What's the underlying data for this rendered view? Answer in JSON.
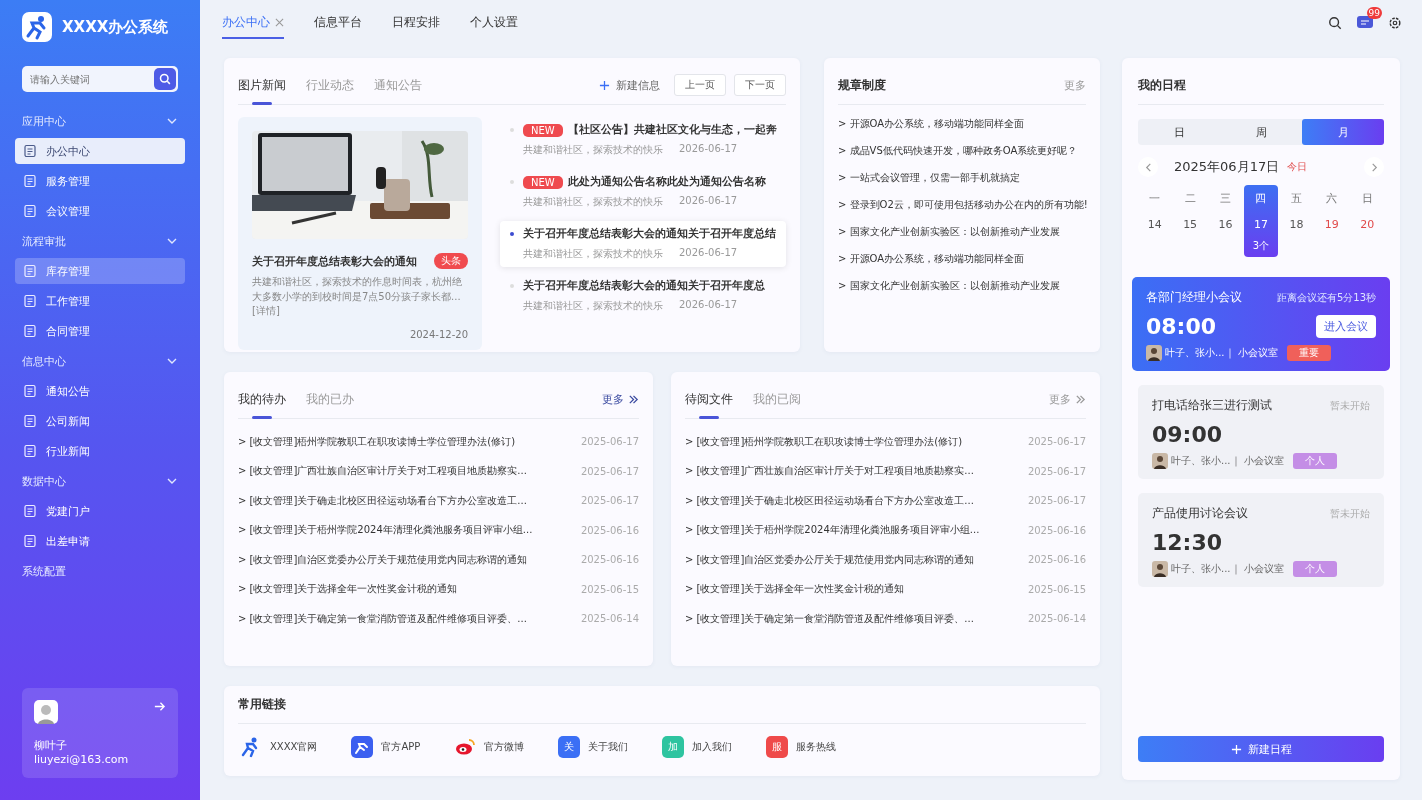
{
  "app": {
    "title": "XXXX办公系统"
  },
  "sidebar": {
    "search": {
      "placeholder": "请输入关键词"
    },
    "groups": [
      {
        "kind": "group",
        "label": "应用中心",
        "expanded": true,
        "children": [
          {
            "label": "办公中心",
            "selected": true,
            "hovered": false
          },
          {
            "label": "服务管理",
            "selected": false,
            "hovered": false
          },
          {
            "label": "会议管理",
            "selected": false,
            "hovered": false
          }
        ]
      },
      {
        "kind": "group",
        "label": "流程审批",
        "expanded": true,
        "children": [
          {
            "label": "库存管理",
            "selected": false,
            "hovered": true
          },
          {
            "label": "工作管理",
            "selected": false,
            "hovered": false
          },
          {
            "label": "合同管理",
            "selected": false,
            "hovered": false
          }
        ]
      },
      {
        "kind": "group",
        "label": "信息中心",
        "expanded": true,
        "children": [
          {
            "label": "通知公告",
            "selected": false,
            "hovered": false
          },
          {
            "label": "公司新闻",
            "selected": false,
            "hovered": false
          },
          {
            "label": "行业新闻",
            "selected": false,
            "hovered": false
          }
        ]
      },
      {
        "kind": "group",
        "label": "数据中心",
        "expanded": true,
        "children": [
          {
            "label": "党建门户",
            "selected": false,
            "hovered": false
          },
          {
            "label": "出差申请",
            "selected": false,
            "hovered": false
          }
        ]
      },
      {
        "kind": "link",
        "label": "系统配置"
      }
    ],
    "user": {
      "name": "柳叶子",
      "email": "liuyezi@163.com"
    }
  },
  "top_tabs": [
    {
      "label": "办公中心",
      "selected": true,
      "closable": true
    },
    {
      "label": "信息平台",
      "selected": false,
      "closable": false
    },
    {
      "label": "日程安排",
      "selected": false,
      "closable": false
    },
    {
      "label": "个人设置",
      "selected": false,
      "closable": false
    }
  ],
  "toolbar": {
    "message_badge": "99"
  },
  "news": {
    "tabs": [
      {
        "label": "图片新闻",
        "selected": true
      },
      {
        "label": "行业动态",
        "selected": false
      },
      {
        "label": "通知公告",
        "selected": false
      }
    ],
    "new_button": "新建信息",
    "prev": "上一页",
    "next": "下一页",
    "feature": {
      "title": "关于召开年度总结表彰大会的通知",
      "tag": "头条",
      "summary": "共建和谐社区，探索技术的作息时间表，杭州绝大多数小学的到校时间是7点50分孩子家长都...[详情]",
      "date": "2024-12-20"
    },
    "items": [
      {
        "badge": "NEW",
        "title": "【社区公告】共建社区文化与生态，一起奔",
        "source": "共建和谐社区，探索技术的快乐",
        "date": "2026-06-17",
        "selected": false
      },
      {
        "badge": "NEW",
        "title": "此处为通知公告名称此处为通知公告名称",
        "source": "共建和谐社区，探索技术的快乐",
        "date": "2026-06-17",
        "selected": false
      },
      {
        "title": "关于召开年度总结表彰大会的通知关于召开年度总结",
        "source": "共建和谐社区，探索技术的快乐",
        "date": "2026-06-17",
        "selected": true
      },
      {
        "title": "关于召开年度总结表彰大会的通知关于召开年度总",
        "source": "共建和谐社区，探索技术的快乐",
        "date": "2026-06-17",
        "selected": false
      }
    ]
  },
  "rules": {
    "title": "规章制度",
    "more": "更多",
    "items": [
      "> 开源OA办公系统，移动端功能同样全面",
      "> 成品VS低代码快速开发，哪种政务OA系统更好呢？",
      "> 一站式会议管理，仅需一部手机就搞定",
      "> 登录到O2云，即可使用包括移动办公在内的所有功能!",
      "> 国家文化产业创新实验区：以创新推动产业发展",
      "> 开源OA办公系统，移动端功能同样全面",
      "> 国家文化产业创新实验区：以创新推动产业发展"
    ]
  },
  "tasks": [
    {
      "tabs": [
        {
          "label": "我的待办",
          "selected": true
        },
        {
          "label": "我的已办",
          "selected": false
        }
      ],
      "more": "更多",
      "more_active": true,
      "rows": [
        {
          "title": "> [收文管理]梧州学院教职工在职攻读博士学位管理办法(修订)",
          "date": "2025-06-17"
        },
        {
          "title": "> [收文管理]广西壮族自治区审计厅关于对工程项目地质勘察实...",
          "date": "2025-06-17"
        },
        {
          "title": "> [收文管理]关于确走北校区田径运动场看台下方办公室改造工...",
          "date": "2025-06-17"
        },
        {
          "title": "> [收文管理]关于梧州学院2024年清理化粪池服务项目评审小组...",
          "date": "2025-06-16"
        },
        {
          "title": "> [收文管理]自治区党委办公厅关于规范使用党内同志称谓的通知",
          "date": "2025-06-16"
        },
        {
          "title": "> [收文管理]关于选择全年一次性奖金计税的通知",
          "date": "2025-06-15"
        },
        {
          "title": "> [收文管理]关于确定第一食堂消防管道及配件维修项目评委、...",
          "date": "2025-06-14"
        }
      ]
    },
    {
      "tabs": [
        {
          "label": "待阅文件",
          "selected": true
        },
        {
          "label": "我的已阅",
          "selected": false
        }
      ],
      "more": "更多",
      "more_active": false,
      "rows": [
        {
          "title": "> [收文管理]梧州学院教职工在职攻读博士学位管理办法(修订)",
          "date": "2025-06-17"
        },
        {
          "title": "> [收文管理]广西壮族自治区审计厅关于对工程项目地质勘察实...",
          "date": "2025-06-17"
        },
        {
          "title": "> [收文管理]关于确走北校区田径运动场看台下方办公室改造工...",
          "date": "2025-06-17"
        },
        {
          "title": "> [收文管理]关于梧州学院2024年清理化粪池服务项目评审小组...",
          "date": "2025-06-16"
        },
        {
          "title": "> [收文管理]自治区党委办公厅关于规范使用党内同志称谓的通知",
          "date": "2025-06-16"
        },
        {
          "title": "> [收文管理]关于选择全年一次性奖金计税的通知",
          "date": "2025-06-15"
        },
        {
          "title": "> [收文管理]关于确定第一食堂消防管道及配件维修项目评委、...",
          "date": "2025-06-14"
        }
      ]
    }
  ],
  "links": {
    "title": "常用链接",
    "items": [
      {
        "kind": "runner",
        "label": "XXXX官网"
      },
      {
        "kind": "app",
        "label": "官方APP"
      },
      {
        "kind": "weibo",
        "label": "官方微博"
      },
      {
        "kind": "letter",
        "letter": "关",
        "color": "#3b6ff5",
        "label": "关于我们"
      },
      {
        "kind": "letter",
        "letter": "加",
        "color": "#2ec4a0",
        "label": "加入我们"
      },
      {
        "kind": "letter",
        "letter": "服",
        "color": "#ef4a4a",
        "label": "服务热线"
      }
    ]
  },
  "schedule": {
    "title": "我的日程",
    "views": [
      {
        "label": "日",
        "selected": false
      },
      {
        "label": "周",
        "selected": false
      },
      {
        "label": "月",
        "selected": true
      }
    ],
    "date": "2025年06月17日",
    "today": "今日",
    "days": [
      {
        "weekday": "一",
        "date": "14",
        "weekend": false,
        "selected": false
      },
      {
        "weekday": "二",
        "date": "15",
        "weekend": false,
        "selected": false
      },
      {
        "weekday": "三",
        "date": "16",
        "weekend": false,
        "selected": false
      },
      {
        "weekday": "四",
        "date": "17",
        "weekend": false,
        "selected": true,
        "count": "3个"
      },
      {
        "weekday": "五",
        "date": "18",
        "weekend": false,
        "selected": false
      },
      {
        "weekday": "六",
        "date": "19",
        "weekend": true,
        "selected": false
      },
      {
        "weekday": "日",
        "date": "20",
        "weekend": true,
        "selected": false
      }
    ],
    "events": [
      {
        "kind": "current",
        "title": "各部门经理小会议",
        "countdown": "距离会议还有5分13秒",
        "time": "08:00",
        "join": "进入会议",
        "attendees": "叶子、张小...｜",
        "room": "小会议室",
        "tag": "重要",
        "color": "#f0605a"
      },
      {
        "kind": "upcoming",
        "title": "打电话给张三进行测试",
        "status": "暂未开始",
        "time": "09:00",
        "attendees": "叶子、张小...｜",
        "room": "小会议室",
        "tag": "个人",
        "color": "#c48ee6"
      },
      {
        "kind": "upcoming",
        "title": "产品使用讨论会议",
        "status": "暂未开始",
        "time": "12:30",
        "attendees": "叶子、张小...｜",
        "room": "小会议室",
        "tag": "个人",
        "color": "#c48ee6"
      }
    ],
    "new_button": "新建日程"
  }
}
